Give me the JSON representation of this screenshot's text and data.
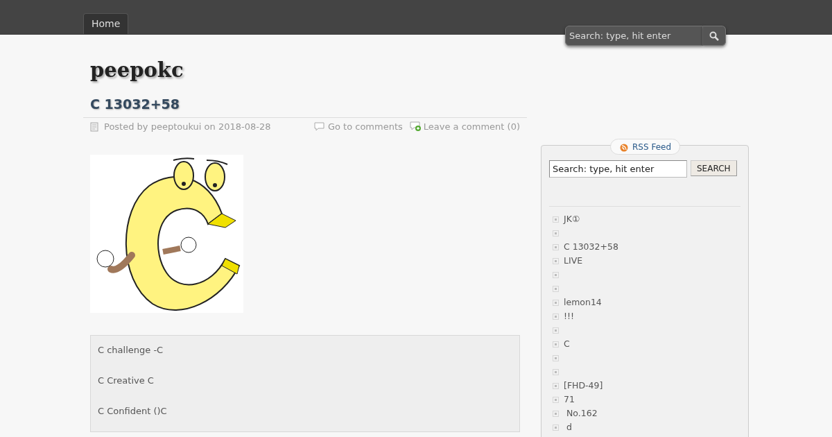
{
  "nav": {
    "tabs": [
      {
        "label": "Home",
        "selected": true
      }
    ]
  },
  "header_search": {
    "placeholder": "Search: type, hit enter"
  },
  "site_title": "peepokc",
  "post": {
    "title": "C 13032+58",
    "meta": "Posted by peeptoukui on 2018-08-28",
    "comments_link": "Go to comments",
    "leave_comment": "Leave a comment (0)",
    "quote": [
      "C challenge -C",
      "C Creative C",
      "C Confident ()C"
    ]
  },
  "sidebar": {
    "rss": "RSS Feed",
    "search": {
      "placeholder": "Search: type, hit enter",
      "button": "SEARCH"
    },
    "links": [
      {
        "kind": "link",
        "label": "JK①"
      },
      {
        "kind": "blank"
      },
      {
        "kind": "link",
        "label": "C 13032+58"
      },
      {
        "kind": "link",
        "label": "LIVE"
      },
      {
        "kind": "blank"
      },
      {
        "kind": "blank"
      },
      {
        "kind": "link",
        "label": "lemon14"
      },
      {
        "kind": "link",
        "label": "!!!"
      },
      {
        "kind": "blank"
      },
      {
        "kind": "link",
        "label": "C"
      },
      {
        "kind": "blank"
      },
      {
        "kind": "blank"
      },
      {
        "kind": "link",
        "label": "[FHD-49]"
      },
      {
        "kind": "link",
        "label": "71"
      },
      {
        "kind": "link",
        "label": " No.162"
      },
      {
        "kind": "link",
        "label": " d"
      }
    ]
  }
}
